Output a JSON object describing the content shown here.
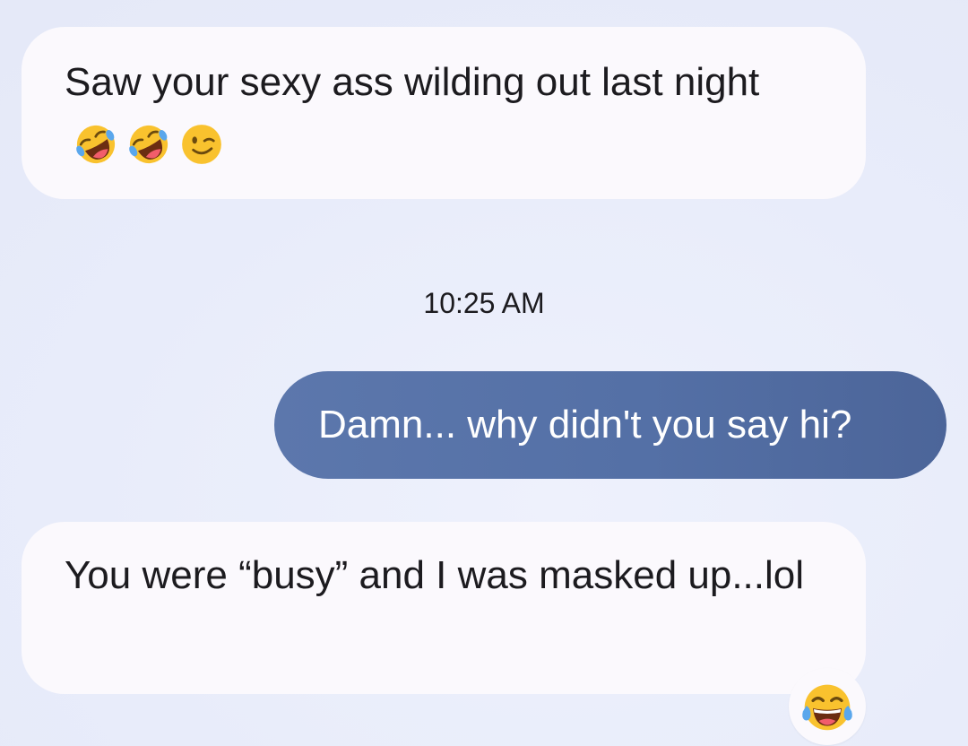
{
  "conversation": {
    "messages": [
      {
        "direction": "incoming",
        "text": "Saw your sexy ass wilding out last night",
        "emojis": [
          "rolling-on-floor-laughing-emoji",
          "rolling-on-floor-laughing-emoji",
          "winking-face-emoji"
        ]
      },
      {
        "direction": "outgoing",
        "text": "Damn... why didn't you say hi?"
      },
      {
        "direction": "incoming",
        "text": "You were “busy” and I was masked up...lol",
        "reaction": "face-with-tears-of-joy-emoji"
      }
    ],
    "timestamp": "10:25 AM"
  },
  "colors": {
    "background": "#e8ecfa",
    "incoming_bubble": "#fbf9fd",
    "outgoing_bubble": "#5470a6",
    "text_dark": "#1c1b1f",
    "text_light": "#ffffff",
    "emoji_yellow": "#f9c22e"
  }
}
